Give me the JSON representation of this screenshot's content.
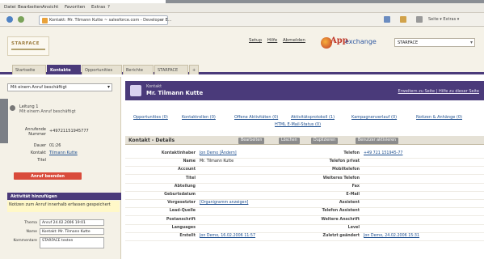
{
  "browser": {
    "menu": [
      "Datei",
      "Bearbeiten",
      "Ansicht",
      "Favoriten",
      "Extras",
      "?"
    ],
    "tab_title": "Kontakt: Mr. Tilmann Kutte ~ salesforce.com - Developer E...",
    "tab_close": "x",
    "tools_right": "Seite ▾ Extras ▾"
  },
  "app": {
    "logo": "STARFACE",
    "top_links": [
      "Setup",
      "Hilfe",
      "Abmelden"
    ],
    "appexchange_brand": "App",
    "appexchange_word": "exchange",
    "app_selector": "STARFACE"
  },
  "tabs": [
    {
      "label": "Startseite",
      "active": false
    },
    {
      "label": "Kontakte",
      "active": true
    },
    {
      "label": "Opportunities",
      "active": false
    },
    {
      "label": "Berichte",
      "active": false
    },
    {
      "label": "STARFACE",
      "active": false
    },
    {
      "label": "+",
      "active": false
    }
  ],
  "sidebar": {
    "recent_select": "Mit einem Anruf beschäftigt",
    "recent_label": "Leitung 1",
    "recent_sub": "Mit einem Anruf beschäftigt",
    "fields": [
      {
        "label": "Anrufende Nummer",
        "value": "+49721151945777",
        "link": false
      },
      {
        "label": "Dauer",
        "value": "01:26",
        "link": false
      },
      {
        "label": "Kontakt",
        "value": "Tilmann Kutte",
        "link": true
      },
      {
        "label": "Titel",
        "value": "",
        "link": false
      }
    ],
    "contact_button": "Anruf beenden",
    "section_header": "Aktivität hinzufügen",
    "section_text": "Notizen zum Anruf innerhalb erfassen gespeichert",
    "mini_fields": [
      {
        "label": "Thema",
        "value": "Anruf 24.02.2006 19:01"
      },
      {
        "label": "Name",
        "value": "Kontakt: Mr. Tilmann Kutte"
      },
      {
        "label": "Kommentare",
        "value": "STARFACE testen"
      }
    ]
  },
  "record": {
    "type": "Kontakt",
    "name": "Mr. Tilmann Kutte",
    "header_links": "Erweitern zu Seite | Hilfe zu dieser Seite",
    "related_links_row1": [
      "Opportunities (0)",
      "Kontaktrollen (0)",
      "Offene Aktivitäten (0)",
      "Aktivitätsprotokoll (1)",
      "Kampagnenverlauf (0)",
      "Notizen & Anhänge (0)"
    ],
    "related_links_row2": [
      "HTML E-Mail-Status (0)"
    ],
    "detail_title": "Kontakt - Details",
    "buttons": [
      "Bearbeiten",
      "Löschen",
      "Duplizieren",
      "Benutzer aktivieren"
    ]
  },
  "details_left": [
    {
      "label": "Kontaktinhaber",
      "value": "Jon Demo [Ändern]",
      "link": true
    },
    {
      "label": "Name",
      "value": "Mr. Tilmann Kutte",
      "link": false
    },
    {
      "label": "Account",
      "value": "",
      "link": false
    },
    {
      "label": "Titel",
      "value": "",
      "link": false
    },
    {
      "label": "Abteilung",
      "value": "",
      "link": false
    },
    {
      "label": "Geburtsdatum",
      "value": "",
      "link": false
    },
    {
      "label": "Vorgesetzter",
      "value": "[Organigramm anzeigen]",
      "link": true
    },
    {
      "label": "Lead-Quelle",
      "value": "",
      "link": false
    },
    {
      "label": "Postanschrift",
      "value": "",
      "link": false
    },
    {
      "label": "Languages",
      "value": "",
      "link": false
    },
    {
      "label": "Erstellt",
      "value": "Jon Demo, 16.02.2006 11:57",
      "link": true
    }
  ],
  "details_right": [
    {
      "label": "Telefon",
      "value": "+49 721 151945-77",
      "link": true
    },
    {
      "label": "Telefon privat",
      "value": "",
      "link": false
    },
    {
      "label": "Mobiltelefon",
      "value": "",
      "link": false
    },
    {
      "label": "Weiteres Telefon",
      "value": "",
      "link": false
    },
    {
      "label": "Fax",
      "value": "",
      "link": false
    },
    {
      "label": "E-Mail",
      "value": "",
      "link": false
    },
    {
      "label": "Assistent",
      "value": "",
      "link": false
    },
    {
      "label": "Telefon Assistent",
      "value": "",
      "link": false
    },
    {
      "label": "Weitere Anschrift",
      "value": "",
      "link": false
    },
    {
      "label": "Level",
      "value": "",
      "link": false
    },
    {
      "label": "Zuletzt geändert",
      "value": "Jon Demo, 24.02.2006 15:31",
      "link": true
    }
  ]
}
